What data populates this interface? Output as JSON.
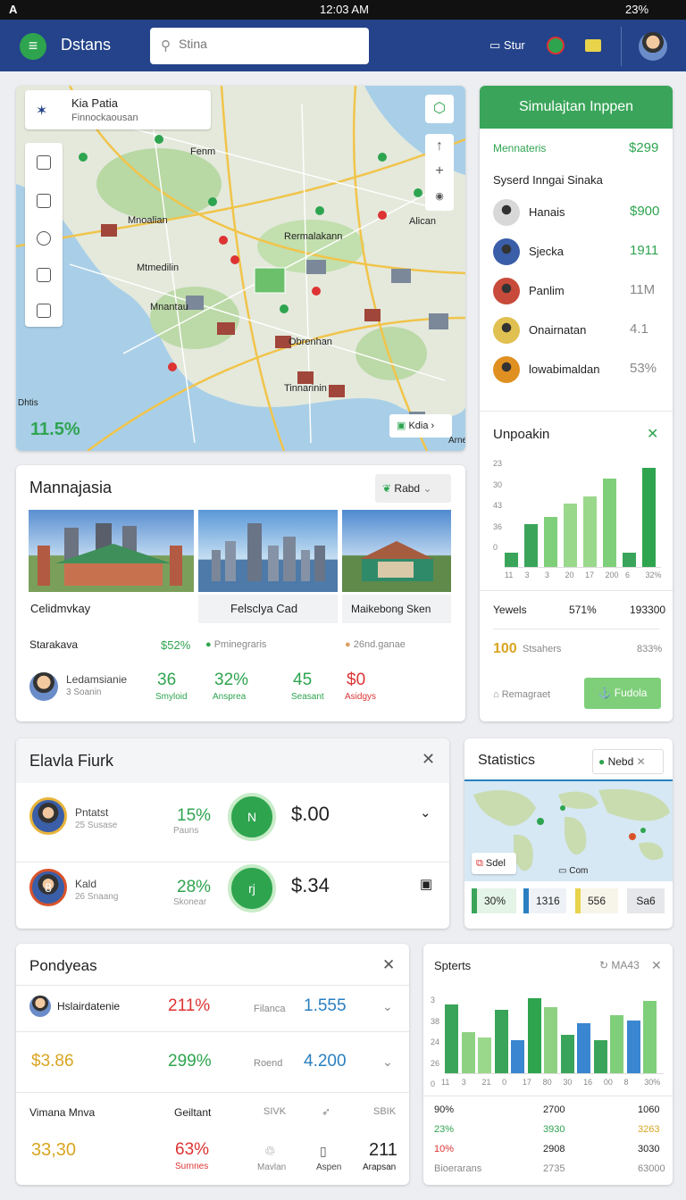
{
  "status": {
    "left": "A",
    "time": "12:03 AM",
    "right": "23%"
  },
  "app": {
    "title": "Dstans",
    "search_placeholder": "Stina",
    "nav_item": "Stur"
  },
  "map": {
    "place_title": "Kia Patia",
    "place_sub": "Finnockaousan",
    "labels": [
      "Fenm",
      "Mnoalian",
      "Rermalakann",
      "Mtmedilin",
      "Alican",
      "Obrenhan",
      "Mnantau",
      "Tinnarinin",
      "Dhtis",
      "Arne"
    ],
    "percent": "11.5%",
    "chip": "Kdia"
  },
  "sim": {
    "header": "Simulajtan Inppen",
    "menu_label": "Mennateris",
    "menu_value": "$299",
    "subtitle": "Syserd Inngai Sinaka",
    "items": [
      {
        "name": "Hanais",
        "value": "$900",
        "color": "#2ea44f"
      },
      {
        "name": "Sjecka",
        "value": "1911",
        "color": "#2ea44f"
      },
      {
        "name": "Panlim",
        "value": "11M",
        "color": "#888"
      },
      {
        "name": "Onairnatan",
        "value": "4.1",
        "color": "#888"
      },
      {
        "name": "lowabimaldan",
        "value": "53%",
        "color": "#888"
      }
    ]
  },
  "chart1": {
    "title": "Unpoakin",
    "yticks": [
      "23",
      "30",
      "43",
      "36",
      "0"
    ],
    "xticks": [
      "11",
      "3",
      "3",
      "20",
      "17",
      "200",
      "6",
      "32%"
    ]
  },
  "chart_data": [
    {
      "type": "bar",
      "title": "Unpoakin",
      "categories": [
        "11",
        "3",
        "3",
        "20",
        "17",
        "200",
        "6",
        "32%"
      ],
      "values": [
        4,
        12,
        14,
        18,
        20,
        25,
        4,
        28
      ],
      "ylim": [
        0,
        30
      ]
    },
    {
      "type": "bar",
      "title": "Spterts",
      "categories": [
        "11",
        "3",
        "21",
        "0",
        "17",
        "80",
        "30",
        "16",
        "00",
        "8",
        "30%"
      ],
      "values": [
        25,
        15,
        13,
        23,
        12,
        27,
        24,
        14,
        18,
        12,
        21,
        19,
        26
      ],
      "ylim": [
        0,
        30
      ]
    }
  ],
  "yewels": {
    "a": "Yewels",
    "b": "571%",
    "c": "193300",
    "d": "100",
    "e": "Stsahers",
    "f": "833%",
    "g": "Remagraet",
    "h": "Fudola"
  },
  "manna": {
    "title": "Mannajasia",
    "btn": "Rabd",
    "tiles": [
      "Celidmvkay",
      "Felsclya Cad",
      "Maikebong Sken"
    ],
    "row1": [
      "Starakava",
      "$52%",
      "Pminegraris",
      "26nd.ganae"
    ],
    "person": "Ledamsianie",
    "person_sub": "3 Soanin",
    "stats": [
      {
        "v": "36",
        "l": "Smyloid",
        "c": "#2ea44f"
      },
      {
        "v": "32%",
        "l": "Ansprea",
        "c": "#2ea44f"
      },
      {
        "v": "45",
        "l": "Seasant",
        "c": "#2ea44f"
      },
      {
        "v": "$0",
        "l": "Asidgys",
        "c": "#d33"
      }
    ]
  },
  "elavla": {
    "title": "Elavla Fiurk",
    "rows": [
      {
        "name": "Pntatst",
        "sub": "25 Susase",
        "pct": "15%",
        "pct_sub": "Pauns",
        "badge": "N",
        "amt": "$.00",
        "avatar": "8"
      },
      {
        "name": "Kald",
        "sub": "26 Snaang",
        "pct": "28%",
        "pct_sub": "Skonear",
        "badge": "rj",
        "amt": "$.34",
        "avatar": "8"
      }
    ]
  },
  "stats": {
    "title": "Statistics",
    "tag": "Nebd",
    "sdel": "Sdel",
    "com": "Com",
    "chips": [
      "30%",
      "1316",
      "556",
      "Sa6"
    ]
  },
  "pond": {
    "title": "Pondyeas",
    "r1": [
      "Hslairdatenie",
      "211%",
      "Filanca",
      "1.555"
    ],
    "r2": [
      "$3.86",
      "299%",
      "Roend",
      "4.200"
    ],
    "hdr": [
      "Vimana Mnva",
      "Geiltant",
      "SIVK",
      "SBIK"
    ],
    "r3": [
      "33,30",
      "63%",
      "Surnnes",
      "Mavlan",
      "Aspen",
      "211",
      "Arapsan"
    ]
  },
  "spt": {
    "title": "Spterts",
    "meta": "MA43",
    "yticks": [
      "3",
      "38",
      "24",
      "26",
      "0"
    ],
    "xticks": [
      "11",
      "3",
      "21",
      "0",
      "17",
      "80",
      "30",
      "16",
      "00",
      "8",
      "30%"
    ],
    "rows": [
      [
        "90%",
        "2700",
        "1060"
      ],
      [
        "23%",
        "3930",
        "3263"
      ],
      [
        "10%",
        "2908",
        "3030"
      ],
      [
        "Bioerarans",
        "2735",
        "63000"
      ]
    ]
  }
}
